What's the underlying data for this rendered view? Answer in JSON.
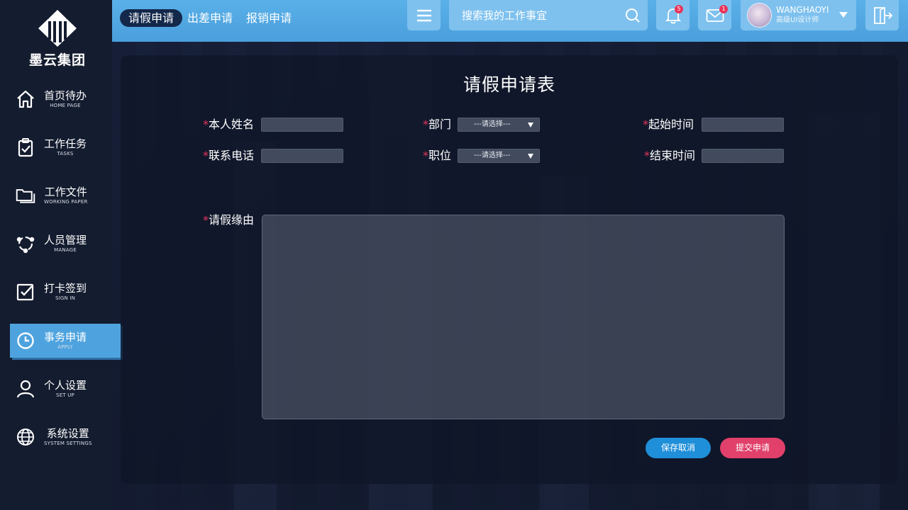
{
  "brand": {
    "name": "墨云集团"
  },
  "sidebar": {
    "items": [
      {
        "zh": "首页待办",
        "en": "HOME PAGE",
        "icon": "home-icon"
      },
      {
        "zh": "工作任务",
        "en": "TASKS",
        "icon": "clipboard-check-icon"
      },
      {
        "zh": "工作文件",
        "en": "WORKING PAPER",
        "icon": "folder-icon"
      },
      {
        "zh": "人员管理",
        "en": "MANAGE",
        "icon": "people-network-icon"
      },
      {
        "zh": "打卡签到",
        "en": "SIGN IN",
        "icon": "checkbox-icon"
      },
      {
        "zh": "事务申请",
        "en": "APPLY",
        "icon": "clock-icon",
        "active": true
      },
      {
        "zh": "个人设置",
        "en": "SET UP",
        "icon": "user-icon"
      },
      {
        "zh": "系统设置",
        "en": "SYSTEM SETTINGS",
        "icon": "globe-icon"
      }
    ]
  },
  "header": {
    "tabs": [
      {
        "label": "请假申请",
        "active": true
      },
      {
        "label": "出差申请"
      },
      {
        "label": "报销申请"
      }
    ],
    "search_placeholder": "搜索我的工作事宜",
    "notifications_count": "5",
    "messages_count": "1",
    "user": {
      "name": "WANGHAOYI",
      "role": "高级UI设计师"
    }
  },
  "form": {
    "title": "请假申请表",
    "required_mark": "*",
    "labels": {
      "name": "本人姓名",
      "department": "部门",
      "start_time": "起始时间",
      "phone": "联系电话",
      "position": "职位",
      "end_time": "结束时间",
      "reason": "请假缘由"
    },
    "select_placeholder": "---请选择---",
    "buttons": {
      "save": "保存取消",
      "submit": "提交申请"
    }
  },
  "colors": {
    "accent": "#4ea3de",
    "topbar": "#5ab0e8",
    "required": "#e8335a",
    "save": "#1f8fd9",
    "submit": "#e0406a",
    "sidebar": "#141c2f"
  }
}
